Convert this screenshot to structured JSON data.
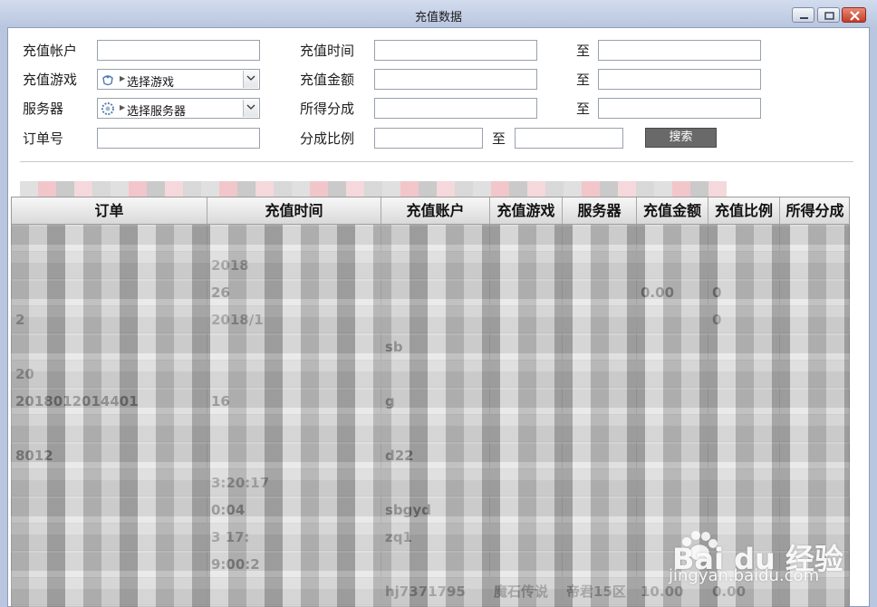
{
  "window": {
    "title": "充值数据"
  },
  "form": {
    "account_label": "充值帐户",
    "game_label": "充值游戏",
    "server_label": "服务器",
    "order_label": "订单号",
    "time_label": "充值时间",
    "amount_label": "充值金额",
    "share_label": "所得分成",
    "ratio_label": "分成比例",
    "to_label": "至",
    "game_select_value": "选择游戏",
    "server_select_value": "选择服务器",
    "search_button": "搜索"
  },
  "grid": {
    "columns": [
      "订单",
      "充值时间",
      "充值账户",
      "充值游戏",
      "服务器",
      "充值金额",
      "充值比例",
      "所得分成"
    ],
    "rows": [
      [
        "",
        "",
        "",
        "",
        "",
        "",
        "",
        ""
      ],
      [
        "",
        "2018",
        "",
        "",
        "",
        "",
        "",
        ""
      ],
      [
        "",
        "26",
        "",
        "",
        "",
        "0.00",
        "0",
        ""
      ],
      [
        "2",
        "2018/1",
        "",
        "",
        "",
        "",
        "0",
        ""
      ],
      [
        "",
        "",
        "sb",
        "",
        "",
        "",
        "",
        ""
      ],
      [
        "20",
        "",
        "",
        "",
        "",
        "",
        "",
        ""
      ],
      [
        "2018012014401",
        "16",
        "g",
        "",
        "",
        "",
        "",
        ""
      ],
      [
        "",
        "",
        "",
        "",
        "",
        "",
        "",
        ""
      ],
      [
        "8012",
        "",
        "d22",
        "",
        "",
        "",
        "",
        ""
      ],
      [
        "",
        "3:20:17",
        "",
        "",
        "",
        "",
        "",
        ""
      ],
      [
        "",
        "0:04",
        "sbgyd",
        "",
        "",
        "",
        "",
        ""
      ],
      [
        "",
        "3 17:",
        "zq1",
        "",
        "",
        "",
        "",
        ""
      ],
      [
        "",
        "9:00:2",
        "",
        "",
        "",
        "",
        "",
        ""
      ],
      [
        "",
        "",
        "hj7371795",
        "魔石传说",
        "帝君15区",
        "10.00",
        "0.00",
        ""
      ]
    ]
  },
  "watermark": {
    "brand": "Bai du 经验",
    "site": "jingyan.baidu.com"
  },
  "colors": {
    "titlebar": "#b9c6df",
    "search_button_bg": "#696969",
    "grid_odd_row": "#d6d6d6",
    "grid_even_row": "#ffffff",
    "close_button": "#c43d26"
  }
}
